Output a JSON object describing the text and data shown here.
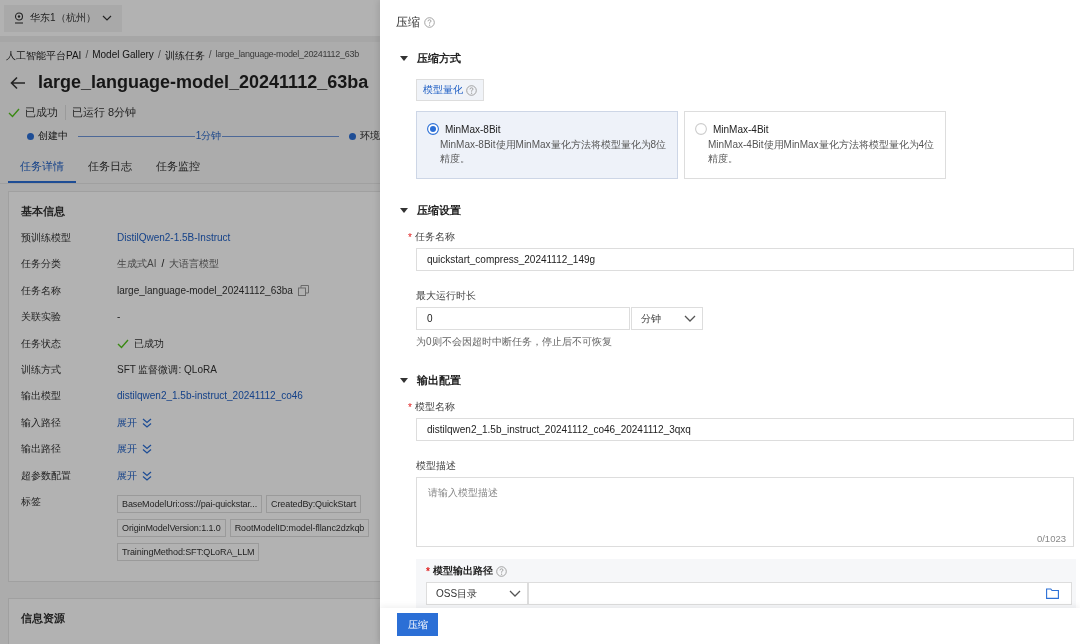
{
  "region_selector": {
    "label": "华东1（杭州）"
  },
  "breadcrumb": {
    "separator": "/",
    "items": [
      "人工智能平台PAI",
      "Model Gallery",
      "训练任务",
      "large_language-model_20241112_63b"
    ]
  },
  "page_title": "large_language-model_20241112_63ba",
  "status": {
    "label": "已成功",
    "runtime": "已运行 8分钟"
  },
  "timeline": {
    "steps": [
      "创建中",
      "环境"
    ],
    "durations": [
      "1分钟"
    ]
  },
  "tabs": [
    {
      "label": "任务详情",
      "selected": true
    },
    {
      "label": "任务日志",
      "selected": false
    },
    {
      "label": "任务监控",
      "selected": false
    }
  ],
  "basic_info": {
    "title": "基本信息",
    "rows": [
      {
        "label": "预训练模型",
        "kind": "link",
        "value": "DistilQwen2-1.5B-Instruct"
      },
      {
        "label": "任务分类",
        "kind": "category",
        "parts": [
          "生成式AI",
          "大语言模型"
        ],
        "separator": "/"
      },
      {
        "label": "任务名称",
        "kind": "copy",
        "value": "large_language-model_20241112_63ba"
      },
      {
        "label": "关联实验",
        "kind": "text",
        "value": "-"
      },
      {
        "label": "任务状态",
        "kind": "status",
        "value": "已成功"
      },
      {
        "label": "训练方式",
        "kind": "text",
        "value": "SFT 监督微调: QLoRA"
      },
      {
        "label": "输出模型",
        "kind": "link",
        "value": "distilqwen2_1.5b-instruct_20241112_co46"
      },
      {
        "label": "输入路径",
        "kind": "expand",
        "value": "展开"
      },
      {
        "label": "输出路径",
        "kind": "expand",
        "value": "展开"
      },
      {
        "label": "超参数配置",
        "kind": "expand",
        "value": "展开"
      },
      {
        "label": "标签",
        "kind": "tags",
        "tags": [
          "BaseModelUri:oss://pai-quickstar...",
          "CreatedBy:QuickStart",
          "OriginModelVersion:1.1.0",
          "RootModelID:model-fllanc2dzkqb",
          "TrainingMethod:SFT:QLoRA_LLM"
        ]
      }
    ]
  },
  "info_resources": {
    "title": "信息资源"
  },
  "drawer": {
    "title": "压缩",
    "compress_method": {
      "title": "压缩方式",
      "tab": "模型量化",
      "options": [
        {
          "name": "MinMax-8Bit",
          "description": "MinMax-8Bit使用MinMax量化方法将模型量化为8位精度。",
          "selected": true
        },
        {
          "name": "MinMax-4Bit",
          "description": "MinMax-4Bit使用MinMax量化方法将模型量化为4位精度。",
          "selected": false
        }
      ]
    },
    "compress_settings": {
      "title": "压缩设置",
      "task_name": {
        "label": "任务名称",
        "required": true,
        "required_mark": "*",
        "value": "quickstart_compress_20241112_149g"
      },
      "max_runtime": {
        "label": "最大运行时长",
        "value": "0",
        "unit": "分钟",
        "hint": "为0则不会因超时中断任务，停止后不可恢复"
      }
    },
    "output_config": {
      "title": "输出配置",
      "model_name": {
        "label": "模型名称",
        "required": true,
        "required_mark": "*",
        "value": "distilqwen2_1.5b_instruct_20241112_co46_20241112_3qxq"
      },
      "model_description": {
        "label": "模型描述",
        "placeholder": "请输入模型描述",
        "counter": "0/1023"
      },
      "output_path": {
        "label": "模型输出路径",
        "required": true,
        "required_mark": "*",
        "type": "OSS目录"
      }
    },
    "submit_button": "压缩"
  }
}
